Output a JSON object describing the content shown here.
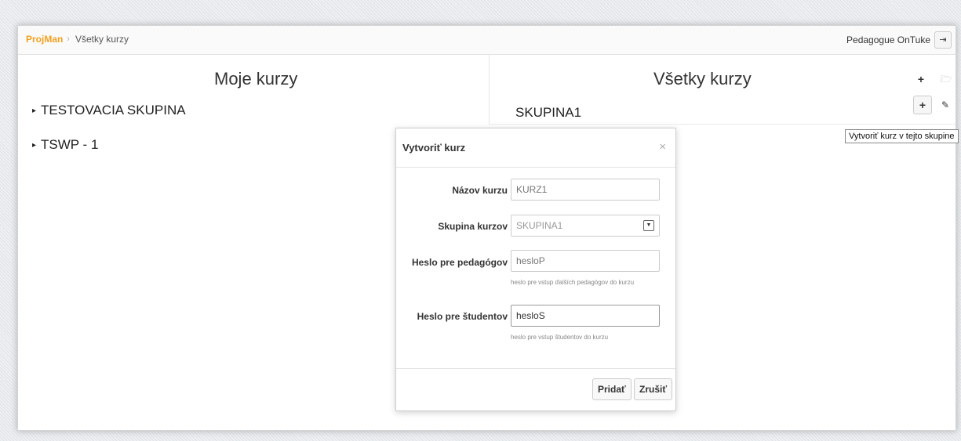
{
  "navbar": {
    "brand": "ProjMan",
    "separator": "›",
    "breadcrumb": "Všetky kurzy",
    "user": "Pedagogue OnTuke",
    "logout_icon": "⇥"
  },
  "left": {
    "title": "Moje kurzy",
    "groups": [
      "TESTOVACIA SKUPINA",
      "TSWP - 1"
    ],
    "caret": "▸"
  },
  "right": {
    "title": "Všetky kurzy",
    "group": "SKUPINA1",
    "add_icon": "+",
    "folder_icon": "🗁",
    "edit_icon": "✎",
    "delete_icon": "×",
    "tooltip": "Vytvoriť kurz v tejto skupine"
  },
  "modal": {
    "title": "Vytvoriť kurz",
    "close": "×",
    "fields": {
      "name": {
        "label": "Názov kurzu",
        "placeholder": "KURZ1"
      },
      "group": {
        "label": "Skupina kurzov",
        "value": "SKUPINA1"
      },
      "teacher_pw": {
        "label": "Heslo pre pedagógov",
        "placeholder": "hesloP",
        "help": "heslo pre vstup ďalších pedagógov do kurzu"
      },
      "student_pw": {
        "label": "Heslo pre študentov",
        "value": "hesloS",
        "help": "heslo pre vstup študentov do kurzu"
      }
    },
    "submit": "Pridať",
    "cancel": "Zrušiť"
  }
}
